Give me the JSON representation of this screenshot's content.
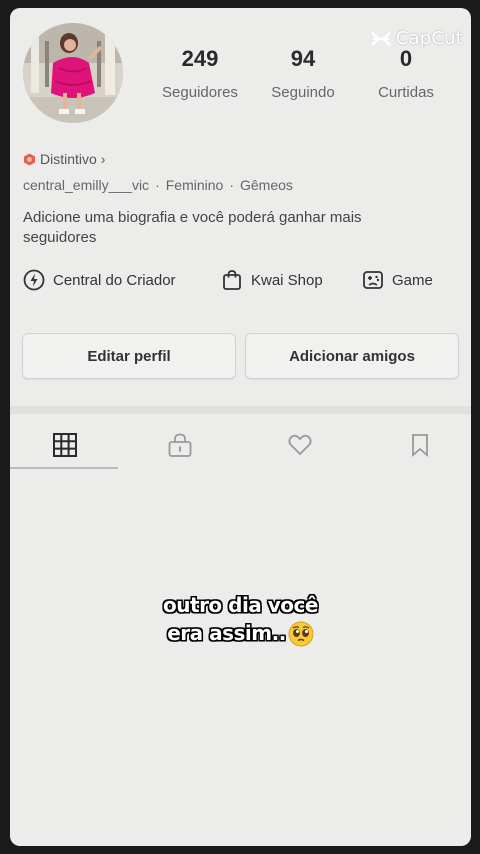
{
  "watermark": {
    "text": "CapCut"
  },
  "profile": {
    "stats": [
      {
        "value": "249",
        "label": "Seguidores"
      },
      {
        "value": "94",
        "label": "Seguindo"
      },
      {
        "value": "0",
        "label": "Curtidas"
      }
    ],
    "badge": "Distintivo",
    "badge_chevron": "›",
    "username": "central_emilly___vic",
    "gender": "Feminino",
    "sign": "Gêmeos",
    "separator": "·",
    "bio": "Adicione uma biografia e você poderá ganhar mais seguidores"
  },
  "shortcuts": [
    {
      "label": "Central do Criador",
      "icon": "lightning-icon"
    },
    {
      "label": "Kwai Shop",
      "icon": "shopping-bag-icon"
    },
    {
      "label": "Game",
      "icon": "gamepad-icon"
    }
  ],
  "buttons": {
    "edit": "Editar perfil",
    "add_friends": "Adicionar amigos"
  },
  "tabs": [
    {
      "icon": "grid-icon",
      "active": true
    },
    {
      "icon": "lock-icon",
      "active": false
    },
    {
      "icon": "heart-icon",
      "active": false
    },
    {
      "icon": "bookmark-icon",
      "active": false
    }
  ],
  "caption": {
    "line1": "outro dia você",
    "line2": "era assim..",
    "emoji": "pleading-face-emoji"
  },
  "colors": {
    "background": "#ececeb",
    "badge_accent": "#e2624f",
    "dress": "#e0137a"
  }
}
